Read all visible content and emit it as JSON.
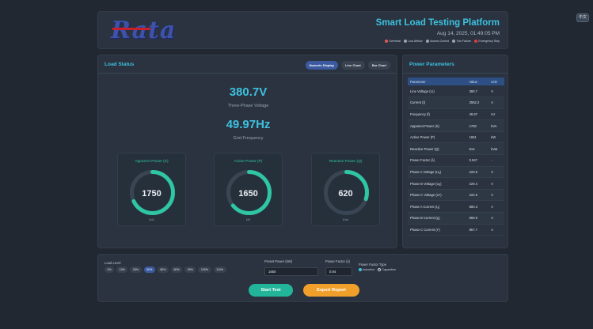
{
  "lang_button": "中文",
  "header": {
    "logo_text": "Rata",
    "title": "Smart Load Testing Platform",
    "datetime": "Aug 14, 2025, 01:49:05 PM",
    "indicators": [
      {
        "label": "Overheat",
        "color": "#e05a5a"
      },
      {
        "label": "Low Airflow",
        "color": "#9aa5b3"
      },
      {
        "label": "Access Control",
        "color": "#9aa5b3"
      },
      {
        "label": "Fan Failure",
        "color": "#9aa5b3"
      },
      {
        "label": "Emergency Stop",
        "color": "#e03c3c"
      }
    ]
  },
  "load_status": {
    "title": "Load Status",
    "tabs": [
      "Numeric Display",
      "Line Chart",
      "Bar Chart"
    ],
    "active_tab": 0,
    "voltage_value": "380.7V",
    "voltage_label": "Three-Phase Voltage",
    "frequency_value": "49.97Hz",
    "frequency_label": "Grid Frequency",
    "gauges": [
      {
        "title": "Apparent Power (S)",
        "value": "1750",
        "unit": "kVA",
        "fraction": 0.68
      },
      {
        "title": "Active Power (P)",
        "value": "1650",
        "unit": "kW",
        "fraction": 0.64
      },
      {
        "title": "Reactive Power (Q)",
        "value": "620",
        "unit": "kVar",
        "fraction": 0.3
      }
    ],
    "accent": "#2fc6a3"
  },
  "power_parameters": {
    "title": "Power Parameters",
    "headers": [
      "Parameter",
      "Value",
      "Unit"
    ],
    "rows": [
      [
        "Line Voltage (Uₗ)",
        "380.7",
        "V"
      ],
      [
        "Current (I)",
        "2552.2",
        "A"
      ],
      [
        "Frequency (f)",
        "49.97",
        "Hz"
      ],
      [
        "Apparent Power (S)",
        "1750",
        "kVA"
      ],
      [
        "Active Power (P)",
        "1651",
        "kW"
      ],
      [
        "Reactive Power (Q)",
        "614",
        "kVar"
      ],
      [
        "Power Factor (λ)",
        "0.947",
        "-"
      ],
      [
        "Phase A Voltage (Uₐ)",
        "220.6",
        "V"
      ],
      [
        "Phase B Voltage (Uᵦ)",
        "220.4",
        "V"
      ],
      [
        "Phase C Voltage (Uᶜ)",
        "222.6",
        "V"
      ],
      [
        "Phase A Current (Iₐ)",
        "880.3",
        "A"
      ],
      [
        "Phase B Current (Iᵦ)",
        "659.9",
        "A"
      ],
      [
        "Phase C Current (Iᶜ)",
        "857.7",
        "A"
      ]
    ]
  },
  "controls": {
    "load_level_label": "Load Level",
    "load_levels": [
      "0%",
      "10%",
      "25%",
      "50%",
      "65%",
      "80%",
      "90%",
      "100%",
      "110%"
    ],
    "active_level": 3,
    "preset_power_label": "Preset Power (kW)",
    "preset_power_value": "1650",
    "power_factor_label": "Power Factor (λ)",
    "power_factor_value": "0.94",
    "pf_type_label": "Power Factor Type",
    "pf_options": [
      "Inductive",
      "Capacitive"
    ],
    "pf_selected": 0,
    "start_label": "Start Test",
    "export_label": "Export Report"
  }
}
